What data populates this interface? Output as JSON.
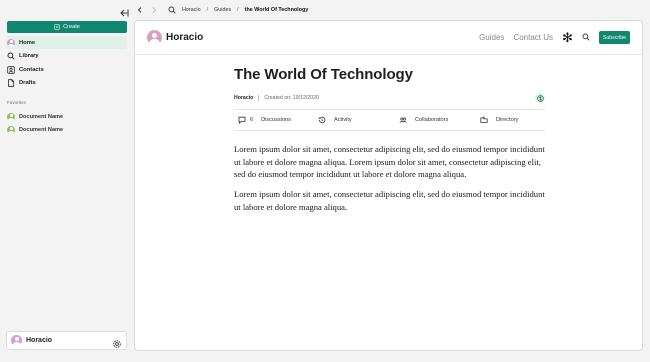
{
  "sidebar": {
    "create_label": "Create",
    "nav_items": [
      {
        "label": "Home",
        "icon": "avatar"
      },
      {
        "label": "Library",
        "icon": "search-icon"
      },
      {
        "label": "Contacts",
        "icon": "contacts-icon"
      },
      {
        "label": "Drafts",
        "icon": "file-icon"
      }
    ],
    "favorites_title": "Favorites",
    "favorites": [
      {
        "label": "Document Name"
      },
      {
        "label": "Document Name"
      }
    ],
    "user_name": "Horacio"
  },
  "topbar": {
    "breadcrumb": [
      "Horacio",
      "Guides",
      "the World Of Technology"
    ],
    "separator": "/"
  },
  "header": {
    "brand": "Horacio",
    "nav": [
      "Guides",
      "Contact Us"
    ],
    "subscribe_label": "Subscribe"
  },
  "article": {
    "title": "The World Of Technology",
    "author": "Horacio",
    "created": "Created on: 19/12/2020",
    "tabs": [
      {
        "count": "6",
        "label": "Discussions"
      },
      {
        "label": "Activity"
      },
      {
        "label": "Collaborators"
      },
      {
        "label": "Directory"
      }
    ],
    "paragraphs": [
      "Lorem ipsum dolor sit amet, consectetur adipiscing elit, sed do eiusmod tempor incididunt ut labore et dolore magna aliqua. Lorem ipsum dolor sit amet, consectetur adipiscing elit, sed do eiusmod tempor incididunt ut labore et dolore magna aliqua.",
      "Lorem ipsum dolor sit amet, consectetur adipiscing elit, sed do eiusmod tempor incididunt ut labore et dolore magna aliqua."
    ]
  },
  "colors": {
    "accent": "#10876e",
    "active_bg": "#e1f1e9",
    "avatar_pink": "#d7a2c2",
    "avatar_green": "#8fc26c"
  }
}
